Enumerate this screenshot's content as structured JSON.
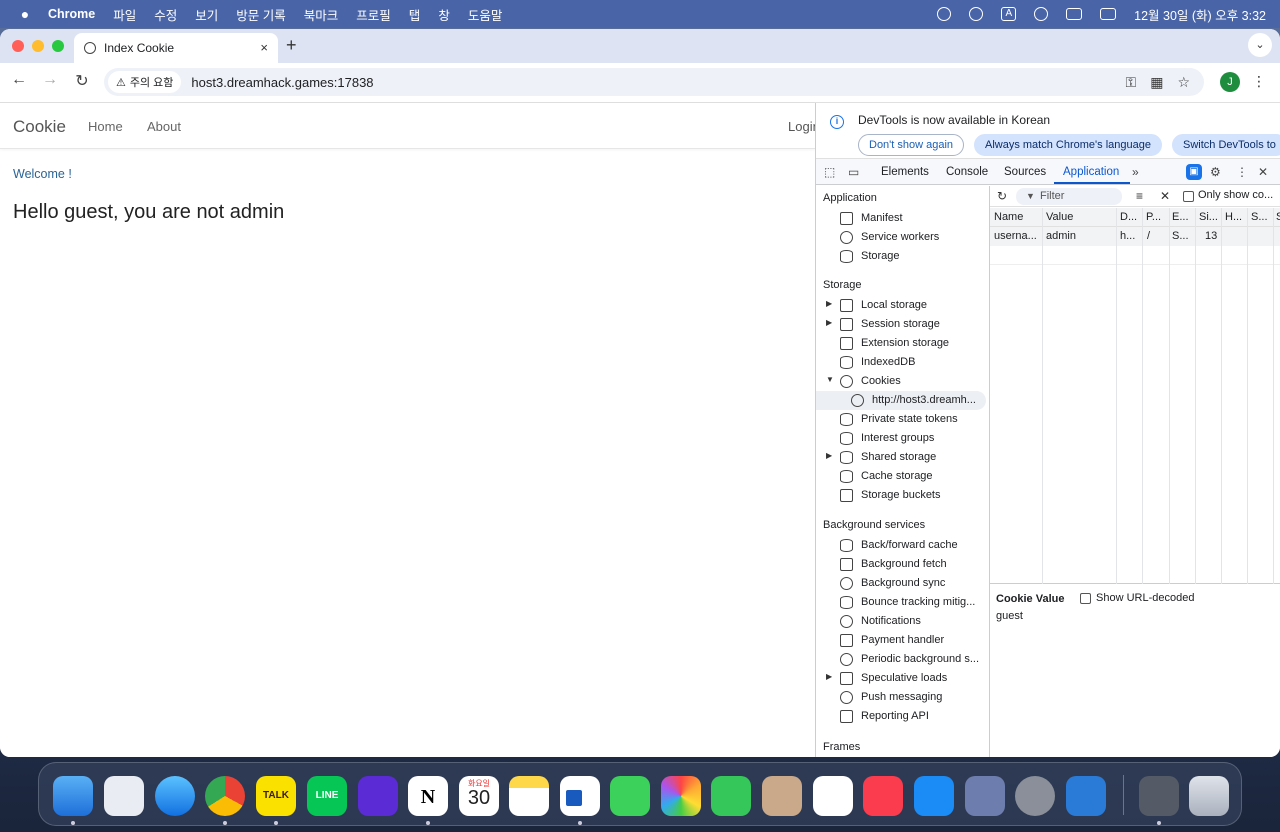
{
  "menubar": {
    "apple": "",
    "app_name": "Chrome",
    "menus": [
      "파일",
      "수정",
      "보기",
      "방문 기록",
      "북마크",
      "프로필",
      "탭",
      "창",
      "도움말"
    ],
    "input_indicator": "A",
    "clock": "12월 30일 (화) 오후 3:32"
  },
  "browser": {
    "tab_title": "Index Cookie",
    "tab_close": "×",
    "new_tab": "+",
    "tab_menu": "⌄",
    "security_label": "주의 요함",
    "url": "host3.dreamhack.games:17838",
    "profile_initial": "J"
  },
  "page": {
    "brand": "Cookie",
    "nav_home": "Home",
    "nav_about": "About",
    "nav_login": "Login",
    "welcome": "Welcome !",
    "heading": "Hello guest, you are not admin"
  },
  "devtools": {
    "infobar": {
      "message": "DevTools is now available in Korean",
      "btn_dont_show": "Don't show again",
      "btn_match": "Always match Chrome's language",
      "btn_switch": "Switch DevTools to"
    },
    "tabs": [
      "Elements",
      "Console",
      "Sources",
      "Application"
    ],
    "more_tabs": "»",
    "active_tab": "Application",
    "sidebar": {
      "application_title": "Application",
      "application_items": [
        "Manifest",
        "Service workers",
        "Storage"
      ],
      "storage_title": "Storage",
      "storage_items": [
        "Local storage",
        "Session storage",
        "Extension storage",
        "IndexedDB",
        "Cookies"
      ],
      "cookie_origin": "http://host3.dreamh...",
      "storage_items_after": [
        "Private state tokens",
        "Interest groups",
        "Shared storage",
        "Cache storage",
        "Storage buckets"
      ],
      "background_title": "Background services",
      "background_items": [
        "Back/forward cache",
        "Background fetch",
        "Background sync",
        "Bounce tracking mitig...",
        "Notifications",
        "Payment handler",
        "Periodic background s...",
        "Speculative loads",
        "Push messaging",
        "Reporting API"
      ],
      "frames_title": "Frames"
    },
    "filter_placeholder": "Filter",
    "only_show": "Only show co...",
    "table": {
      "headers": [
        "Name",
        "Value",
        "D...",
        "P...",
        "E...",
        "Si...",
        "H...",
        "S...",
        "S"
      ],
      "rows": [
        [
          "userna...",
          "admin",
          "h...",
          "/",
          "S...",
          "13"
        ]
      ]
    },
    "cookie_value_title": "Cookie Value",
    "show_url_decoded": "Show URL-decoded",
    "cookie_value": "guest"
  },
  "dock": {
    "calendar_day_label": "화요일",
    "calendar_date": "30",
    "kakao_label": "TALK",
    "line_label": "LINE",
    "notion_label": "N"
  },
  "colors": {
    "accent": "#0b57d0",
    "menubar": "#4664aa",
    "link": "#2a6496"
  }
}
